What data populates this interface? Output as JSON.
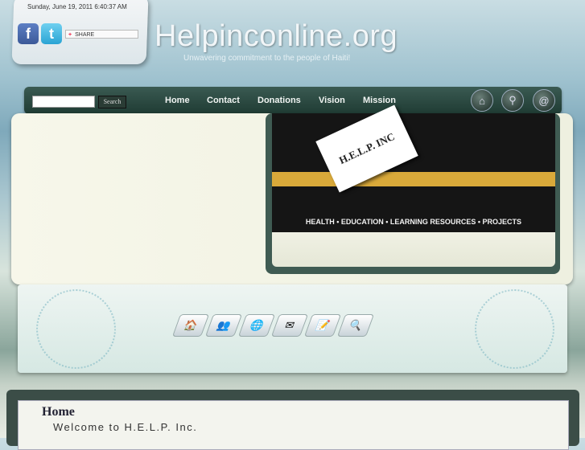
{
  "header": {
    "date_text": "Sunday, June 19, 2011 6:40:37 AM",
    "site_title": "Helpinconline.org",
    "tagline": "Unwavering commitment to the people of Haiti!",
    "facebook_glyph": "f",
    "twitter_glyph": "t",
    "share_label": "SHARE"
  },
  "nav": {
    "search_button": "Search",
    "items": [
      "Home",
      "Contact",
      "Donations",
      "Vision",
      "Mission"
    ],
    "round_icons": [
      "home-icon",
      "magnifier-icon",
      "email-icon"
    ]
  },
  "banner": {
    "card_text": "H.E.L.P. INC",
    "caption": "HEALTH • EDUCATION • LEARNING RESOURCES • PROJECTS"
  },
  "quick_icons": [
    "home-folder-icon",
    "users-icon",
    "globe-icon",
    "mail-icon",
    "notes-icon",
    "search-icon"
  ],
  "content": {
    "heading": "Home",
    "welcome": "Welcome to H.E.L.P. Inc."
  }
}
